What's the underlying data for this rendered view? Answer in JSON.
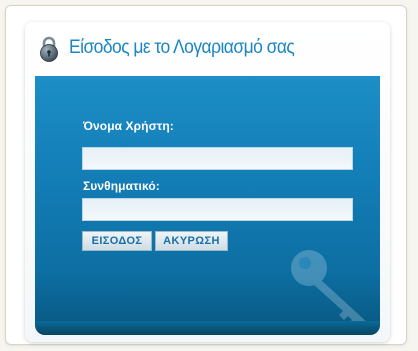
{
  "login": {
    "title": "Είσοδος με το Λογαριασμό σας",
    "username_label": "Όνομα Χρήστη:",
    "username_value": "",
    "password_label": "Συνθηματικό:",
    "password_value": "",
    "login_button": "ΕΙΣΟΔΟΣ",
    "cancel_button": "ΑΚΥΡΩΣΗ"
  },
  "icons": {
    "lock": "padlock-icon",
    "key": "key-icon"
  },
  "colors": {
    "title": "#1c86c4",
    "panel_blue": "#147fb8",
    "button_text": "#1a6fa6"
  }
}
